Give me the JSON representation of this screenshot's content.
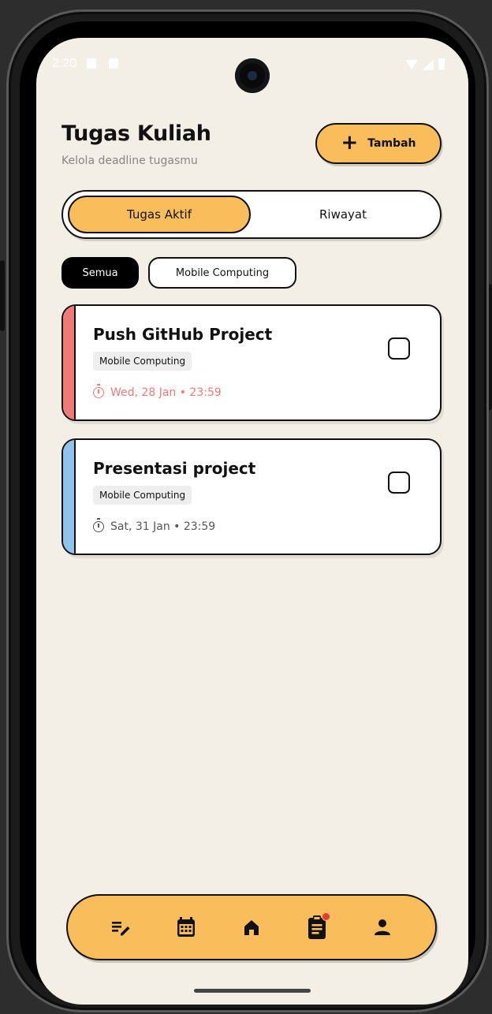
{
  "status": {
    "time": "2:20"
  },
  "header": {
    "title": "Tugas Kuliah",
    "subtitle": "Kelola deadline tugasmu",
    "add_button": {
      "icon": "plus-icon",
      "label": "Tambah"
    }
  },
  "tabs": {
    "active": "Tugas Aktif",
    "inactive": "Riwayat"
  },
  "filters": {
    "items": [
      {
        "label": "Semua",
        "selected": true
      },
      {
        "label": "Mobile Computing",
        "selected": false
      }
    ]
  },
  "tasks": [
    {
      "title": "Push GitHub Project",
      "course": "Mobile Computing",
      "due": "Wed, 28 Jan • 23:59",
      "accent_color": "#f07a78",
      "due_color": "#f07a78",
      "done": false
    },
    {
      "title": "Presentasi project",
      "course": "Mobile Computing",
      "due": "Sat, 31 Jan • 23:59",
      "accent_color": "#8fc3ec",
      "due_color": "#555555",
      "done": false
    }
  ],
  "bottom_nav": {
    "items": [
      {
        "icon": "edit-list-icon"
      },
      {
        "icon": "calendar-icon"
      },
      {
        "icon": "home-icon"
      },
      {
        "icon": "clipboard-icon",
        "badge": true
      },
      {
        "icon": "person-icon"
      }
    ]
  },
  "colors": {
    "accent": "#f9bd5c",
    "background": "#f3efe6",
    "text": "#111111"
  }
}
